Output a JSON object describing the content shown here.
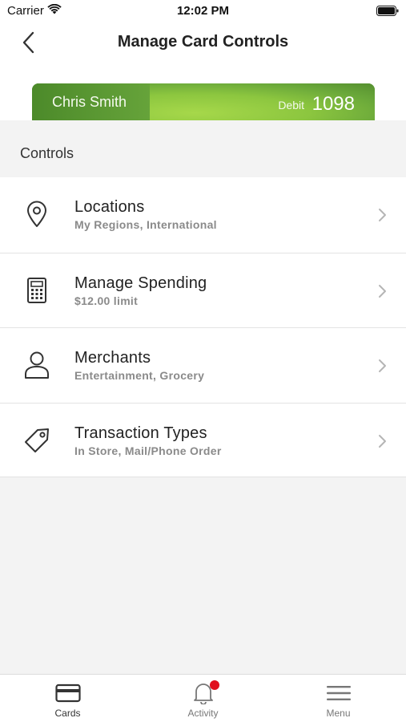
{
  "status_bar": {
    "carrier": "Carrier",
    "time": "12:02 PM"
  },
  "nav": {
    "title": "Manage Card Controls",
    "back_icon": "chevron-left-icon"
  },
  "card": {
    "holder_name": "Chris Smith",
    "card_type": "Debit",
    "last4": "1098",
    "colors": {
      "primary": "#5a9a30",
      "highlight": "#a6d84a"
    }
  },
  "section": {
    "title": "Controls"
  },
  "controls": [
    {
      "title": "Locations",
      "subtitle": "My Regions, International",
      "icon": "location-pin-icon"
    },
    {
      "title": "Manage Spending",
      "subtitle": "$12.00 limit",
      "icon": "calculator-icon"
    },
    {
      "title": "Merchants",
      "subtitle": "Entertainment, Grocery",
      "icon": "person-icon"
    },
    {
      "title": "Transaction Types",
      "subtitle": "In Store, Mail/Phone Order",
      "icon": "tag-icon"
    }
  ],
  "tabs": [
    {
      "label": "Cards",
      "icon": "card-icon",
      "active": true
    },
    {
      "label": "Activity",
      "icon": "bell-icon",
      "badge": true,
      "badge_color": "#e0101e"
    },
    {
      "label": "Menu",
      "icon": "hamburger-menu-icon"
    }
  ]
}
